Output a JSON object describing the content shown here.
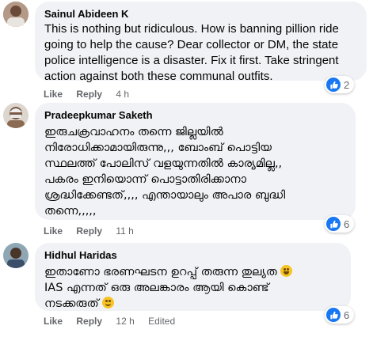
{
  "comments": [
    {
      "author": "Sainul Abideen K",
      "lines": [
        "This is nothing but ridiculous. How is banning pillion ride",
        "going to help the cause? Dear collector or DM, the state",
        "police intelligence is a disaster. Fix it first. Take stringent",
        "action against both these communal outfits."
      ],
      "like_label": "Like",
      "reply_label": "Reply",
      "time": "4 h",
      "reaction_count": "2",
      "edited": ""
    },
    {
      "author": "Pradeepkumar Saketh",
      "lines": [
        "ഇരുചക്രവാഹനം തന്നെ ജില്ലയിൽ",
        "നിരോധിക്കാമായിരുന്നു,,, ബോംബ് പൊട്ടിയ",
        "സ്ഥലത്ത് പോലിസ് വളയുന്നതിൽ കാര്യമില്ല,,",
        "പകരം ഇനിയൊന്ന് പൊട്ടാതിരിക്കാനാ",
        "ശ്രദ്ധിക്കേണ്ടത്,,,, എന്തായാലും അപാര ബുദ്ധി",
        "തന്നെ,,,,,"
      ],
      "like_label": "Like",
      "reply_label": "Reply",
      "time": "11 h",
      "reaction_count": "6",
      "edited": ""
    },
    {
      "author": "Hidhul Haridas",
      "lines": [
        "ഇതാണോ ഭരണഘടന ഉറപ്പ് തരുന്ന തുല്യത",
        "IAS എന്നത് ഒരു അലങ്കാരം ആയി കൊണ്ട്",
        "നടക്കരുത്"
      ],
      "like_label": "Like",
      "reply_label": "Reply",
      "time": "12 h",
      "reaction_count": "6",
      "edited": "Edited"
    }
  ],
  "icons": {
    "reaction": "like-thumb-icon",
    "emoji_1": "laughing-face-icon",
    "emoji_2": "smiling-face-icon"
  },
  "colors": {
    "bubble": "#f0f2f5",
    "meta": "#65676b",
    "like_blue": "#1877f2"
  }
}
